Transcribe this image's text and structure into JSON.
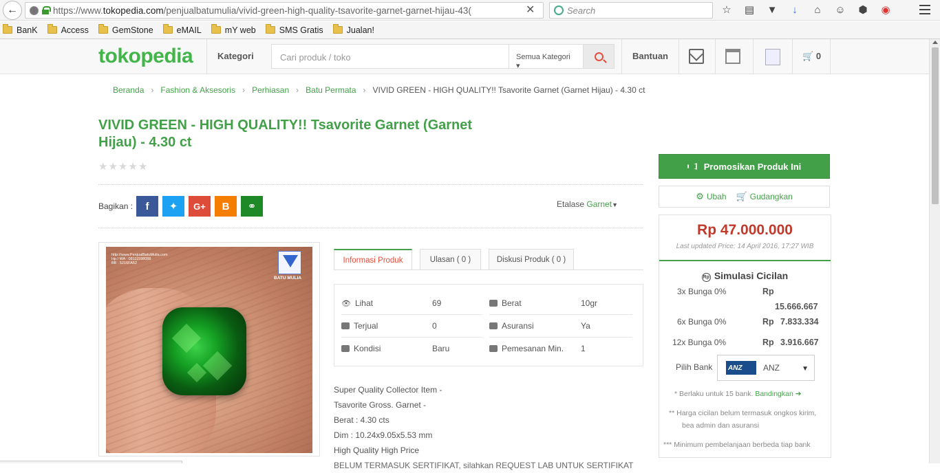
{
  "browser": {
    "url_prefix": "https://www.",
    "url_host": "tokopedia.com",
    "url_path": "/penjualbatumulia/vivid-green-high-quality-tsavorite-garnet-garnet-hijau-43(",
    "search_placeholder": "Search",
    "bookmarks": [
      "BanK",
      "Access",
      "GemStone",
      "eMAIL",
      "mY web",
      "SMS Gratis",
      "Jualan!"
    ]
  },
  "site": {
    "logo": "tokopedia",
    "kategori": "Kategori",
    "search_placeholder": "Cari produk / toko",
    "search_category": "Semua Kategori",
    "bantuan": "Bantuan",
    "cart_count": "0",
    "brand_color": "#42b549"
  },
  "breadcrumb": {
    "items": [
      "Beranda",
      "Fashion & Aksesoris",
      "Perhiasan",
      "Batu Permata"
    ],
    "current": "VIVID GREEN - HIGH QUALITY!! Tsavorite Garnet (Garnet Hijau) - 4.30 ct"
  },
  "product": {
    "title": "VIVID GREEN - HIGH QUALITY!! Tsavorite Garnet (Garnet Hijau) - 4.30 ct",
    "rating_stars": 0,
    "share_label": "Bagikan :",
    "etalase_label": "Etalase",
    "etalase_value": "Garnet",
    "image_watermark": {
      "line1": "http://www.PenjualBatuMulia.com",
      "line2": "Hp / WA : 08111598088",
      "line3": "BB : 5216FA52",
      "logo_caption": "BATU MULIA"
    }
  },
  "tabs": [
    {
      "label": "Informasi Produk"
    },
    {
      "label": "Ulasan ( 0 )"
    },
    {
      "label": "Diskusi Produk ( 0 )"
    }
  ],
  "info": {
    "lihat_label": "Lihat",
    "lihat_value": "69",
    "berat_label": "Berat",
    "berat_value": "10gr",
    "terjual_label": "Terjual",
    "terjual_value": "0",
    "asuransi_label": "Asuransi",
    "asuransi_value": "Ya",
    "kondisi_label": "Kondisi",
    "kondisi_value": "Baru",
    "pemesanan_label": "Pemesanan Min.",
    "pemesanan_value": "1"
  },
  "description": {
    "lines": [
      "Super Quality Collector Item -",
      "Tsavorite Gross. Garnet -",
      "Berat : 4.30 cts",
      "Dim : 10.24x9.05x5.53 mm",
      "High Quality High Price",
      "BELUM TERMASUK SERTIFIKAT, silahkan REQUEST LAB UNTUK SERTIFIKAT"
    ]
  },
  "sidebar": {
    "promo_button": "Promosikan Produk Ini",
    "ubah": "Ubah",
    "gudangkan": "Gudangkan",
    "price": "Rp 47.000.000",
    "last_updated": "Last updated Price: 14 April 2016, 17:27 WIB",
    "simulasi_title": "Simulasi Cicilan",
    "cicilan": [
      {
        "label": "3x Bunga 0%",
        "currency": "Rp",
        "amount": "15.666.667"
      },
      {
        "label": "6x Bunga 0%",
        "currency": "Rp",
        "amount": "7.833.334"
      },
      {
        "label": "12x Bunga 0%",
        "currency": "Rp",
        "amount": "3.916.667"
      }
    ],
    "pilih_bank_label": "Pilih Bank",
    "bank_selected": "ANZ",
    "bank_logo": "ANZ",
    "note1_prefix": "*",
    "note1": "Berlaku untuk 15 bank.",
    "note1_link": "Bandingkan",
    "note2_prefix": "**",
    "note2_line1": "Harga cicilan belum termasuk ongkos kirim,",
    "note2_line2": "bea admin dan asuransi",
    "note3_prefix": "***",
    "note3": "Minimum pembelanjaan berbeda tiap bank"
  }
}
